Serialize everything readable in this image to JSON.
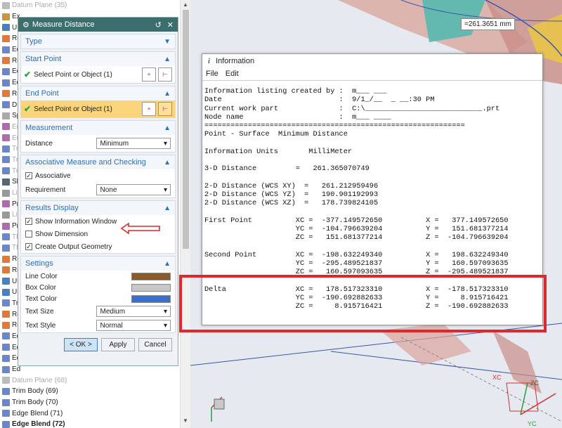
{
  "tree": {
    "items": [
      {
        "label": "Datum Plane (35)",
        "color": "#bbbbbb",
        "dim": true
      },
      {
        "label": "Ex",
        "color": "#c9963a"
      },
      {
        "label": "Un",
        "color": "#4a7fc1"
      },
      {
        "label": "Re",
        "color": "#e07a3a"
      },
      {
        "label": "Ed",
        "color": "#6a87c9"
      },
      {
        "label": "Re",
        "color": "#e07a3a"
      },
      {
        "label": "Ed",
        "color": "#6a87c9"
      },
      {
        "label": "Ed",
        "color": "#6a87c9"
      },
      {
        "label": "Re",
        "color": "#e07a3a"
      },
      {
        "label": "Dr",
        "color": "#6a87c9"
      },
      {
        "label": "Sp",
        "color": "#aaaaaa"
      },
      {
        "label": "En",
        "color": "#b06ab0",
        "dim": true
      },
      {
        "label": "En",
        "color": "#b06ab0",
        "dim": true
      },
      {
        "label": "Tr",
        "color": "#6a87c9",
        "dim": true
      },
      {
        "label": "Tr",
        "color": "#6a87c9",
        "dim": true
      },
      {
        "label": "Tr",
        "color": "#6a87c9",
        "dim": true
      },
      {
        "label": "Sk",
        "color": "#556677"
      },
      {
        "label": "Lir",
        "color": "#999999",
        "dim": true
      },
      {
        "label": "Pr",
        "color": "#b06ab0"
      },
      {
        "label": "Lir",
        "color": "#999999",
        "dim": true
      },
      {
        "label": "Pr",
        "color": "#b06ab0"
      },
      {
        "label": "Th",
        "color": "#6a87c9",
        "dim": true
      },
      {
        "label": "Th",
        "color": "#6a87c9",
        "dim": true
      },
      {
        "label": "Re",
        "color": "#e07a3a"
      },
      {
        "label": "Re",
        "color": "#e07a3a"
      },
      {
        "label": "Un",
        "color": "#4a7fc1"
      },
      {
        "label": "Un",
        "color": "#4a7fc1"
      },
      {
        "label": "Tr",
        "color": "#6a87c9"
      },
      {
        "label": "Re",
        "color": "#e07a3a"
      },
      {
        "label": "Re",
        "color": "#e07a3a"
      },
      {
        "label": "Ed",
        "color": "#6a87c9"
      },
      {
        "label": "Ed",
        "color": "#6a87c9"
      },
      {
        "label": "Ed",
        "color": "#6a87c9"
      },
      {
        "label": "Ed",
        "color": "#6a87c9"
      },
      {
        "label": "Datum Plane (68)",
        "color": "#bbbbbb",
        "dim": true
      },
      {
        "label": "Trim Body (69)",
        "color": "#6a87c9"
      },
      {
        "label": "Trim Body (70)",
        "color": "#6a87c9"
      },
      {
        "label": "Edge Blend (71)",
        "color": "#6a87c9"
      },
      {
        "label": "Edge Blend (72)",
        "color": "#6a87c9",
        "bold": true
      }
    ]
  },
  "dialog": {
    "title": "Measure Distance",
    "type_label": "Type",
    "start_point_label": "Start Point",
    "start_select": "Select Point or Object (1)",
    "end_point_label": "End Point",
    "end_select": "Select Point or Object (1)",
    "measurement_label": "Measurement",
    "distance_label": "Distance",
    "distance_value": "Minimum",
    "assoc_label": "Associative Measure and Checking",
    "associative_label": "Associative",
    "requirement_label": "Requirement",
    "requirement_value": "None",
    "results_label": "Results Display",
    "show_info_label": "Show Information Window",
    "show_dim_label": "Show Dimension",
    "create_geom_label": "Create Output Geometry",
    "settings_label": "Settings",
    "line_color_label": "Line Color",
    "box_color_label": "Box Color",
    "text_color_label": "Text Color",
    "text_size_label": "Text Size",
    "text_size_value": "Medium",
    "text_style_label": "Text Style",
    "text_style_value": "Normal",
    "ok_label": "< OK >",
    "apply_label": "Apply",
    "cancel_label": "Cancel",
    "colors": {
      "line": "#8a5a2b",
      "box": "#c8c8c8",
      "text": "#3a6fd0"
    }
  },
  "info": {
    "title": "Information",
    "menu_file": "File",
    "menu_edit": "Edit",
    "listing": "Information listing created by :  m___ ___\nDate                           :  9/1_/__  _ __:30 PM\nCurrent work part              :  C:\\___________________________.prt\nNode name                      :  m___ ____\n============================================================\nPoint - Surface  Minimum Distance\n\nInformation Units       MilliMeter\n\n3-D Distance         =   261.365070749\n\n2-D Distance (WCS XY)  =   261.212959496\n2-D Distance (WCS YZ)  =   190.901192993\n2-D Distance (WCS XZ)  =   178.739824105\n\nFirst Point          XC =  -377.149572650          X =   377.149572650\n                     YC =  -104.796639204          Y =   151.681377214\n                     ZC =   151.681377214          Z =  -104.796639204\n\nSecond Point         XC =  -198.632249340          X =   198.632249340\n                     YC =  -295.489521837          Y =   160.597093635\n                     ZC =   160.597093635          Z =  -295.489521837\n\nDelta                XC =   178.517323310          X =  -178.517323310\n                     YC =  -190.692882633          Y =     8.915716421\n                     ZC =     8.915716421          Z =  -190.692882633"
  },
  "viewport": {
    "distance_badge": "=261.3651 mm",
    "axis_x": "XC",
    "axis_y": "YC",
    "axis_z": "ZC"
  }
}
